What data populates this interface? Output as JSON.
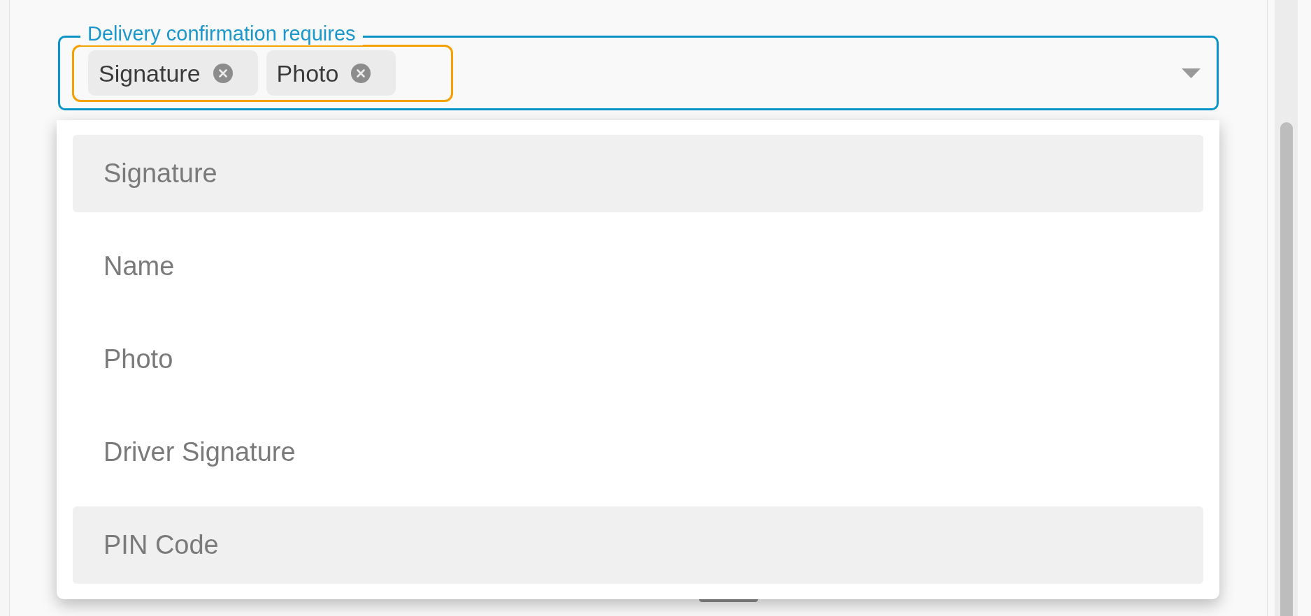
{
  "field": {
    "label": "Delivery confirmation requires",
    "focused": true,
    "expanded": true,
    "chips": [
      {
        "label": "Signature"
      },
      {
        "label": "Photo"
      }
    ]
  },
  "options": [
    {
      "label": "Signature",
      "highlighted": true
    },
    {
      "label": "Name",
      "highlighted": false
    },
    {
      "label": "Photo",
      "highlighted": false
    },
    {
      "label": "Driver Signature",
      "highlighted": false
    },
    {
      "label": "PIN Code",
      "highlighted": true
    }
  ]
}
